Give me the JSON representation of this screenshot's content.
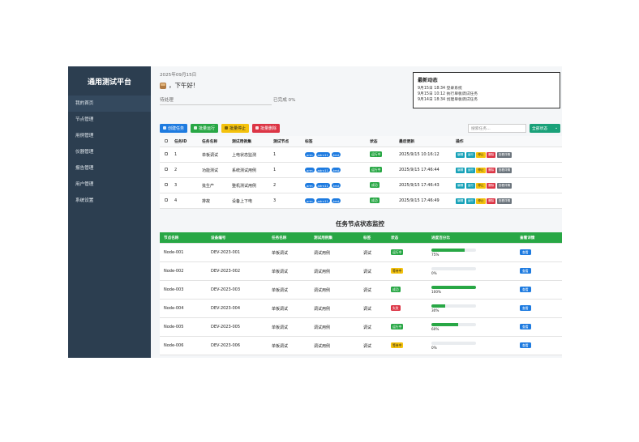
{
  "sidebar": {
    "brand": "通用测试平台",
    "items": [
      {
        "label": "我的首页",
        "active": true
      },
      {
        "label": "节点管理"
      },
      {
        "label": "用例管理"
      },
      {
        "label": "仪器管理"
      },
      {
        "label": "报告管理"
      },
      {
        "label": "用户管理"
      },
      {
        "label": "系统设置"
      }
    ]
  },
  "header": {
    "date": "2025年09月15日",
    "greeting": "，下午好!",
    "pending_label": "待处理",
    "done_label": "已完成 0%"
  },
  "news": {
    "title": "最新动态",
    "items": [
      "9月15日 18:34 登录系统",
      "9月15日 10:12 执行单板调试任务",
      "9月14日 18:34 创建单板调试任务"
    ]
  },
  "toolbar": {
    "create": "创建任务",
    "batch_run": "批量运行",
    "batch_stop": "批量停止",
    "batch_delete": "批量删除",
    "search_placeholder": "搜索任务...",
    "status_filter": "全部状态"
  },
  "task_table": {
    "headers": [
      "任务ID",
      "任务名称",
      "测试用例集",
      "测试节点",
      "标签",
      "状态",
      "最后更新",
      "操作"
    ],
    "rows": [
      {
        "id": "1",
        "name": "单板调试",
        "suite": "上电状态监测",
        "node": "1",
        "tags": [
          "arm",
          "adrv11",
          "test"
        ],
        "status": "运行中",
        "status_type": "green",
        "updated": "2025/9/15 10:16:12"
      },
      {
        "id": "2",
        "name": "功能测试",
        "suite": "系统测试用例",
        "node": "1",
        "tags": [
          "arm",
          "adrv11",
          "test"
        ],
        "status": "运行中",
        "status_type": "green",
        "updated": "2025/9/15 17:46:44"
      },
      {
        "id": "3",
        "name": "批生产",
        "suite": "整机测试用例",
        "node": "2",
        "tags": [
          "arm",
          "adrv11",
          "test"
        ],
        "status": "成功",
        "status_type": "green",
        "updated": "2025/9/15 17:46:43"
      },
      {
        "id": "4",
        "name": "排故",
        "suite": "设备上下电",
        "node": "3",
        "tags": [
          "arm",
          "adrv11",
          "test"
        ],
        "status": "成功",
        "status_type": "green",
        "updated": "2025/9/15 17:46:49"
      }
    ],
    "ops": [
      "编辑",
      "运行",
      "停止",
      "删除",
      "查看详情"
    ]
  },
  "node_section": {
    "title": "任务节点状态监控",
    "headers": [
      "节点名称",
      "设备编号",
      "任务名称",
      "测试用例集",
      "标签",
      "状态",
      "进度百分比",
      "查看详情"
    ],
    "view_label": "查看",
    "rows": [
      {
        "name": "Node-001",
        "device": "DEV-2023-001",
        "task": "单板调试",
        "suite": "调试用例",
        "tag": "调试",
        "status": "运行中",
        "status_type": "green",
        "progress": 75,
        "progress_text": "75%"
      },
      {
        "name": "Node-002",
        "device": "DEV-2023-002",
        "task": "单板调试",
        "suite": "调试用例",
        "tag": "调试",
        "status": "等待中",
        "status_type": "yellow",
        "progress": 0,
        "progress_text": "0%"
      },
      {
        "name": "Node-003",
        "device": "DEV-2023-003",
        "task": "单板调试",
        "suite": "调试用例",
        "tag": "调试",
        "status": "成功",
        "status_type": "green",
        "progress": 100,
        "progress_text": "100%"
      },
      {
        "name": "Node-004",
        "device": "DEV-2023-004",
        "task": "单板调试",
        "suite": "调试用例",
        "tag": "调试",
        "status": "失败",
        "status_type": "red",
        "progress": 30,
        "progress_text": "30%"
      },
      {
        "name": "Node-005",
        "device": "DEV-2023-005",
        "task": "单板调试",
        "suite": "调试用例",
        "tag": "调试",
        "status": "运行中",
        "status_type": "green",
        "progress": 60,
        "progress_text": "60%"
      },
      {
        "name": "Node-006",
        "device": "DEV-2023-006",
        "task": "单板调试",
        "suite": "调试用例",
        "tag": "调试",
        "status": "等待中",
        "status_type": "yellow",
        "progress": 0,
        "progress_text": "0%"
      }
    ]
  }
}
